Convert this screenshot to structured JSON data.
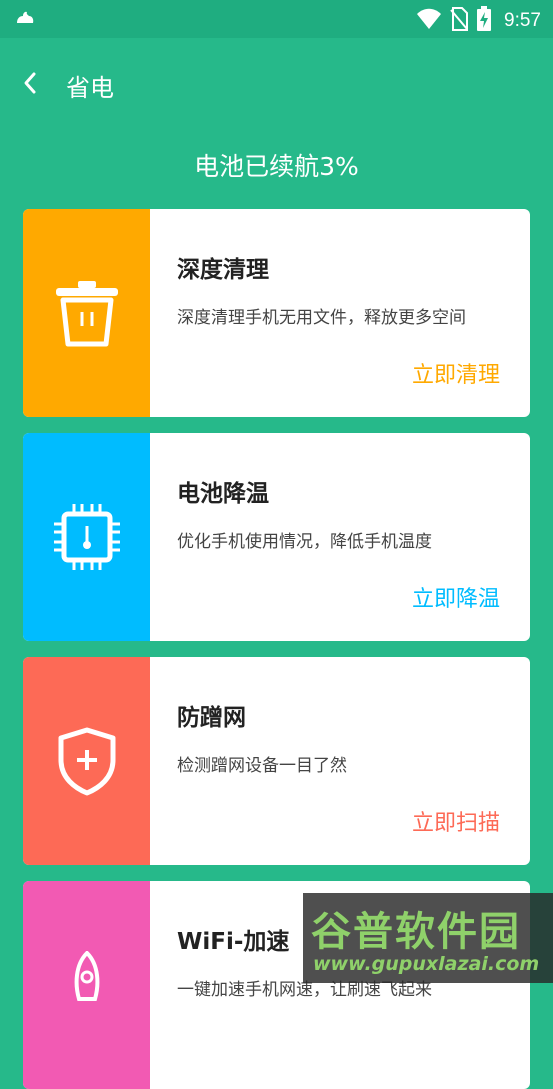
{
  "status_bar": {
    "time": "9:57"
  },
  "header": {
    "title": "省电"
  },
  "battery": {
    "text": "电池已续航3%"
  },
  "cards": [
    {
      "title": "深度清理",
      "desc": "深度清理手机无用文件，释放更多空间",
      "action": "立即清理",
      "color": "#ffa900",
      "icon": "trash-icon"
    },
    {
      "title": "电池降温",
      "desc": "优化手机使用情况，降低手机温度",
      "action": "立即降温",
      "color": "#00bcff",
      "icon": "chip-icon"
    },
    {
      "title": "防蹭网",
      "desc": "检测蹭网设备一目了然",
      "action": "立即扫描",
      "color": "#fd6a56",
      "icon": "shield-icon"
    },
    {
      "title": "WiFi-加速",
      "desc": "一键加速手机网速，让刷速飞起来",
      "action": "",
      "color": "#f25ab3",
      "icon": "rocket-icon"
    }
  ],
  "watermark": {
    "line1": "谷普软件园",
    "line2": "www.gupuxlazai.com"
  }
}
